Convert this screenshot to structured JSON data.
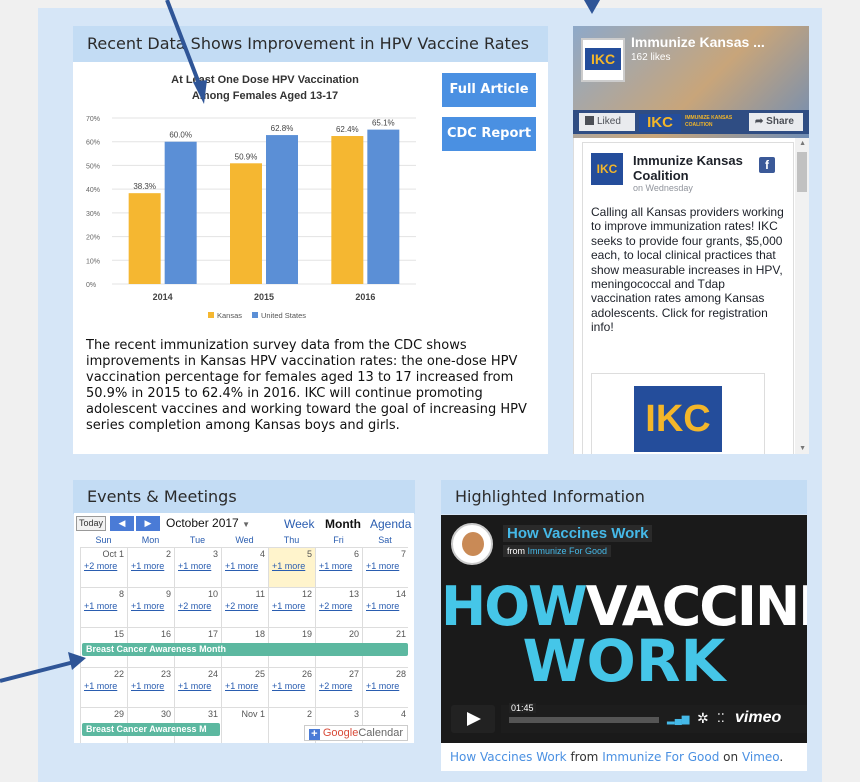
{
  "hpv": {
    "title": "Recent Data Shows Improvement in HPV Vaccine Rates",
    "btn_article": "Full Article",
    "btn_cdc": "CDC Report",
    "body": "The recent immunization survey data from the CDC shows improvements in Kansas HPV vaccination rates: the one-dose HPV vaccination percentage for females aged 13 to 17 increased from 50.9% in 2015 to 62.4% in 2016. IKC will continue promoting adolescent vaccines and working toward the goal of increasing HPV series completion among Kansas boys and girls."
  },
  "chart_data": {
    "type": "bar",
    "title": "At Least One Dose HPV Vaccination",
    "subtitle": "Among Females Aged 13-17",
    "categories": [
      "2014",
      "2015",
      "2016"
    ],
    "series": [
      {
        "name": "Kansas",
        "values": [
          38.3,
          50.9,
          62.4
        ],
        "color": "#f5b731"
      },
      {
        "name": "United States",
        "values": [
          60.0,
          62.8,
          65.1
        ],
        "color": "#5b8fd6"
      }
    ],
    "data_labels": [
      [
        "38.3%",
        "60.0%"
      ],
      [
        "50.9%",
        "62.8%"
      ],
      [
        "62.4%",
        "65.1%"
      ]
    ],
    "yticks": [
      "0%",
      "10%",
      "20%",
      "30%",
      "40%",
      "50%",
      "60%",
      "70%"
    ],
    "ylim": [
      0,
      70
    ],
    "legend_position": "bottom"
  },
  "facebook": {
    "page_name": "Immunize Kansas ...",
    "likes": "162 likes",
    "liked": "Liked",
    "share": "Share",
    "brand_logo": "IKC",
    "cover_tag": "IMMUNIZE KANSAS COALITION",
    "post_author_line1": "Immunize Kansas",
    "post_author_line2": "Coalition",
    "post_time": "on Wednesday",
    "post_text": "Calling all Kansas providers working to improve immunization rates! IKC seeks to provide four grants, $5,000 each, to local clinical practices that show measurable increases in HPV, meningococcal and Tdap vaccination rates among Kansas adolescents. Click for registration info!",
    "fb_icon": "f"
  },
  "events": {
    "title": "Events & Meetings",
    "today": "Today",
    "month_label": "October 2017",
    "view_week": "Week",
    "view_month": "Month",
    "view_agenda": "Agenda",
    "weekdays": [
      "Sun",
      "Mon",
      "Tue",
      "Wed",
      "Thu",
      "Fri",
      "Sat"
    ],
    "weeks": [
      {
        "days": [
          "Oct 1",
          "2",
          "3",
          "4",
          "5",
          "6",
          "7"
        ],
        "more": [
          "+2 more",
          "+1 more",
          "+1 more",
          "+1 more",
          "+1 more",
          "+1 more",
          "+1 more"
        ]
      },
      {
        "days": [
          "8",
          "9",
          "10",
          "11",
          "12",
          "13",
          "14"
        ],
        "more": [
          "+1 more",
          "+1 more",
          "+2 more",
          "+2 more",
          "+1 more",
          "+2 more",
          "+1 more"
        ]
      },
      {
        "days": [
          "15",
          "16",
          "17",
          "18",
          "19",
          "20",
          "21"
        ],
        "more": [
          "",
          "",
          "",
          "",
          "",
          "",
          ""
        ]
      },
      {
        "days": [
          "22",
          "23",
          "24",
          "25",
          "26",
          "27",
          "28"
        ],
        "more": [
          "+1 more",
          "+1 more",
          "+1 more",
          "+1 more",
          "+1 more",
          "+2 more",
          "+1 more"
        ]
      },
      {
        "days": [
          "29",
          "30",
          "31",
          "Nov 1",
          "2",
          "3",
          "4"
        ],
        "more": [
          "",
          "",
          "",
          "",
          "",
          "",
          ""
        ]
      }
    ],
    "event_bar_1": "Breast Cancer Awareness Month",
    "event_bar_2": "Breast Cancer Awareness M",
    "google_calendar": "Google",
    "calendar_word": "Calendar"
  },
  "highlight": {
    "title": "Highlighted Information",
    "video_title": "How Vaccines Work",
    "video_from": "from",
    "video_channel": "Immunize For Good",
    "big_line1a": "HOW",
    "big_line1b": "VACCINES",
    "big_line2": "WORK",
    "time": "01:45",
    "vimeo": "vimeo",
    "caption_title": "How Vaccines Work",
    "caption_from": "from",
    "caption_channel": "Immunize For Good",
    "caption_on": "on",
    "caption_site": "Vimeo",
    "caption_end": "."
  }
}
